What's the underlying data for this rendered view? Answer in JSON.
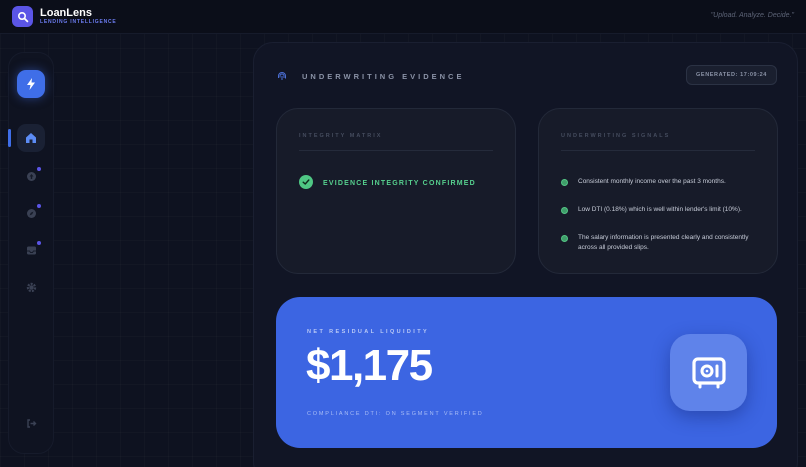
{
  "app": {
    "name": "LoanLens",
    "subtitle": "LENDING INTELLIGENCE",
    "tagline": "\"Upload. Analyze. Decide.\""
  },
  "sidebar": {
    "items": [
      {
        "icon": "bolt-icon",
        "active": false
      },
      {
        "icon": "home-icon",
        "active": true
      },
      {
        "icon": "upload-icon",
        "has_dot": true
      },
      {
        "icon": "compass-icon",
        "has_dot": true
      },
      {
        "icon": "inbox-icon",
        "has_dot": true
      },
      {
        "icon": "gear-icon",
        "has_dot": false
      },
      {
        "icon": "logout-icon"
      }
    ]
  },
  "evidence": {
    "title": "UNDERWRITING EVIDENCE",
    "generated": "GENERATED: 17:09:24"
  },
  "integrity": {
    "title": "INTEGRITY MATRIX",
    "status": "EVIDENCE INTEGRITY CONFIRMED"
  },
  "signals": {
    "title": "UNDERWRITING SIGNALS",
    "items": [
      "Consistent monthly income over the past 3 months.",
      "Low DTI (0.18%) which is well within lender's limit (10%).",
      "The salary information is presented clearly and consistently across all provided slips."
    ]
  },
  "liquidity": {
    "label": "NET RESIDUAL LIQUIDITY",
    "value": "$1,175",
    "sub": "COMPLIANCE DTI: ON SEGMENT VERIFIED"
  },
  "colors": {
    "accent": "#3f6ee8",
    "brand": "#5b55e6",
    "success": "#4fc784",
    "background": "#0e1220"
  }
}
